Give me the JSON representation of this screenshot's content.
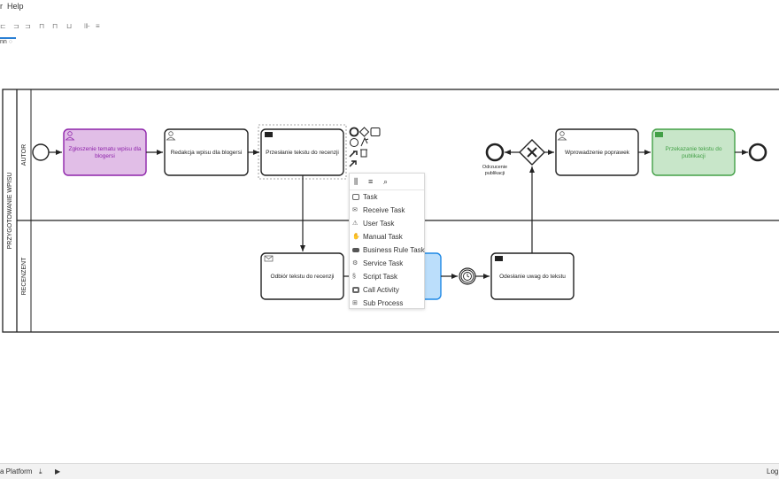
{
  "menubar": {
    "first": "r",
    "help": "Help"
  },
  "toolbar": {
    "icons": [
      "align-left-icon",
      "align-center-icon",
      "align-right-icon",
      "align-top-icon",
      "align-middle-icon",
      "align-bottom-icon",
      "distribute-horizontal-icon",
      "distribute-vertical-icon"
    ]
  },
  "tab": {
    "label": "nn"
  },
  "diagram": {
    "pool_label": "PRZYGOTOWANIE WPISU",
    "lanes": {
      "author": "AUTOR",
      "reviewer": "RECENZENT"
    },
    "tasks": {
      "t1": [
        "Zgłoszenie tematu wpisu dla",
        "blogersi"
      ],
      "t2": [
        "Redakcja wpisu dla blogersi"
      ],
      "t3": [
        "Przesłanie tekstu do recenzji"
      ],
      "t4": [
        "Wprowadzenie poprawek"
      ],
      "t5": [
        "Przekazanie tekstu do",
        "publikacji"
      ],
      "t6": [
        "Odbiór tekstu do recenzji"
      ],
      "t7": [
        "Odesłanie uwag do tekstu"
      ]
    },
    "end_label": [
      "Odrzucenie",
      "publikacji"
    ],
    "colors": {
      "purple_fill": "#e1bee7",
      "purple_stroke": "#8e24aa",
      "purple_text": "#8e24aa",
      "green_fill": "#c8e6c9",
      "green_stroke": "#43a047",
      "green_text": "#43a047",
      "blue_fill": "#bbdefb",
      "blue_stroke": "#1e88e5"
    }
  },
  "replace_menu": {
    "header_icons": [
      "column-icon",
      "list-icon",
      "search-icon"
    ],
    "items": [
      "Task",
      "Receive Task",
      "User Task",
      "Manual Task",
      "Business Rule Task",
      "Service Task",
      "Script Task",
      "Call Activity",
      "Sub Process"
    ]
  },
  "statusbar": {
    "platform": "a Platform",
    "log": "Log"
  }
}
